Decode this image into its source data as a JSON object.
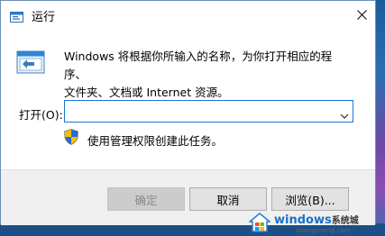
{
  "window": {
    "title": "运行"
  },
  "description": {
    "line1": "Windows 将根据你所输入的名称，为你打开相应的程序、",
    "line2": "文件夹、文档或 Internet 资源。"
  },
  "open": {
    "label": "打开(O):",
    "value": ""
  },
  "admin_note": "使用管理权限创建此任务。",
  "buttons": {
    "ok": "确定",
    "cancel": "取消",
    "browse": "浏览(B)..."
  },
  "watermark": {
    "brand": "windows",
    "cn": "系统城",
    "url": "xitongcheng.com"
  },
  "colors": {
    "accent": "#1a78d2",
    "desktop": "#1c5a9a"
  }
}
